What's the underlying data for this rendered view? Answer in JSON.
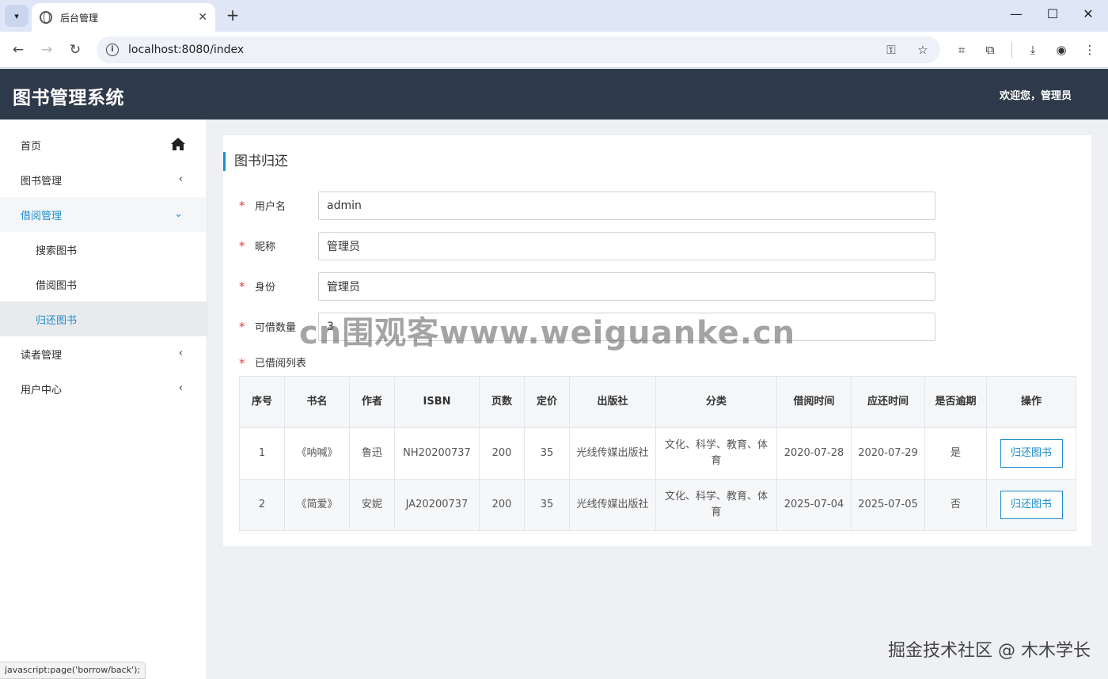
{
  "browser": {
    "tab_title": "后台管理",
    "url": "localhost:8080/index",
    "status_text": "javascript:page('borrow/back');"
  },
  "header": {
    "title": "图书管理系统",
    "welcome": "欢迎您，管理员"
  },
  "sidebar": {
    "items": [
      {
        "label": "首页"
      },
      {
        "label": "图书管理"
      },
      {
        "label": "借阅管理",
        "sub": [
          "搜索图书",
          "借阅图书",
          "归还图书"
        ]
      },
      {
        "label": "读者管理"
      },
      {
        "label": "用户中心"
      }
    ]
  },
  "panel": {
    "title": "图书归还",
    "fields": {
      "username": {
        "label": "用户名",
        "value": "admin"
      },
      "nickname": {
        "label": "昵称",
        "value": "管理员"
      },
      "identity": {
        "label": "身份",
        "value": "管理员"
      },
      "quota": {
        "label": "可借数量",
        "value": "3"
      }
    },
    "table_label": "已借阅列表",
    "columns": [
      "序号",
      "书名",
      "作者",
      "ISBN",
      "页数",
      "定价",
      "出版社",
      "分类",
      "借阅时间",
      "应还时间",
      "是否逾期",
      "操作"
    ],
    "rows": [
      {
        "no": "1",
        "name": "《呐喊》",
        "author": "鲁迅",
        "isbn": "NH20200737",
        "pages": "200",
        "price": "35",
        "publisher": "光线传媒出版社",
        "category": "文化、科学、教育、体育",
        "borrow": "2020-07-28",
        "due": "2020-07-29",
        "overdue": "是",
        "action": "归还图书"
      },
      {
        "no": "2",
        "name": "《简爱》",
        "author": "安妮",
        "isbn": "JA20200737",
        "pages": "200",
        "price": "35",
        "publisher": "光线传媒出版社",
        "category": "文化、科学、教育、体育",
        "borrow": "2025-07-04",
        "due": "2025-07-05",
        "overdue": "否",
        "action": "归还图书"
      }
    ]
  },
  "overlays": {
    "watermark": "cn围观客www.weiguanke.cn",
    "juejin": "掘金技术社区 @ 木木学长"
  }
}
